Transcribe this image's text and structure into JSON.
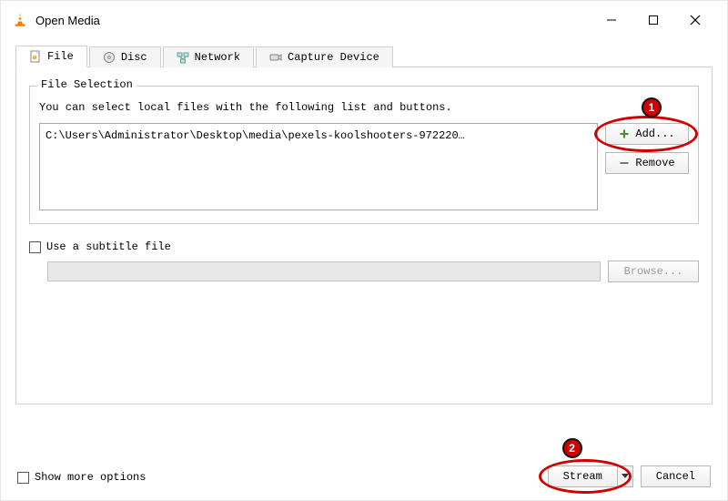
{
  "window": {
    "title": "Open Media"
  },
  "tabs": {
    "file": {
      "label": "File"
    },
    "disc": {
      "label": "Disc"
    },
    "network": {
      "label": "Network"
    },
    "capture": {
      "label": "Capture Device"
    }
  },
  "file_selection": {
    "legend": "File Selection",
    "description": "You can select local files with the following list and buttons.",
    "items": [
      "C:\\Users\\Administrator\\Desktop\\media\\pexels-koolshooters-972220…"
    ],
    "add_label": "Add...",
    "remove_label": "Remove"
  },
  "subtitle": {
    "checkbox_label": "Use a subtitle file",
    "browse_label": "Browse..."
  },
  "more_options_label": "Show more options",
  "actions": {
    "primary": "Stream",
    "cancel": "Cancel"
  },
  "callouts": {
    "add_num": "1",
    "stream_num": "2"
  }
}
